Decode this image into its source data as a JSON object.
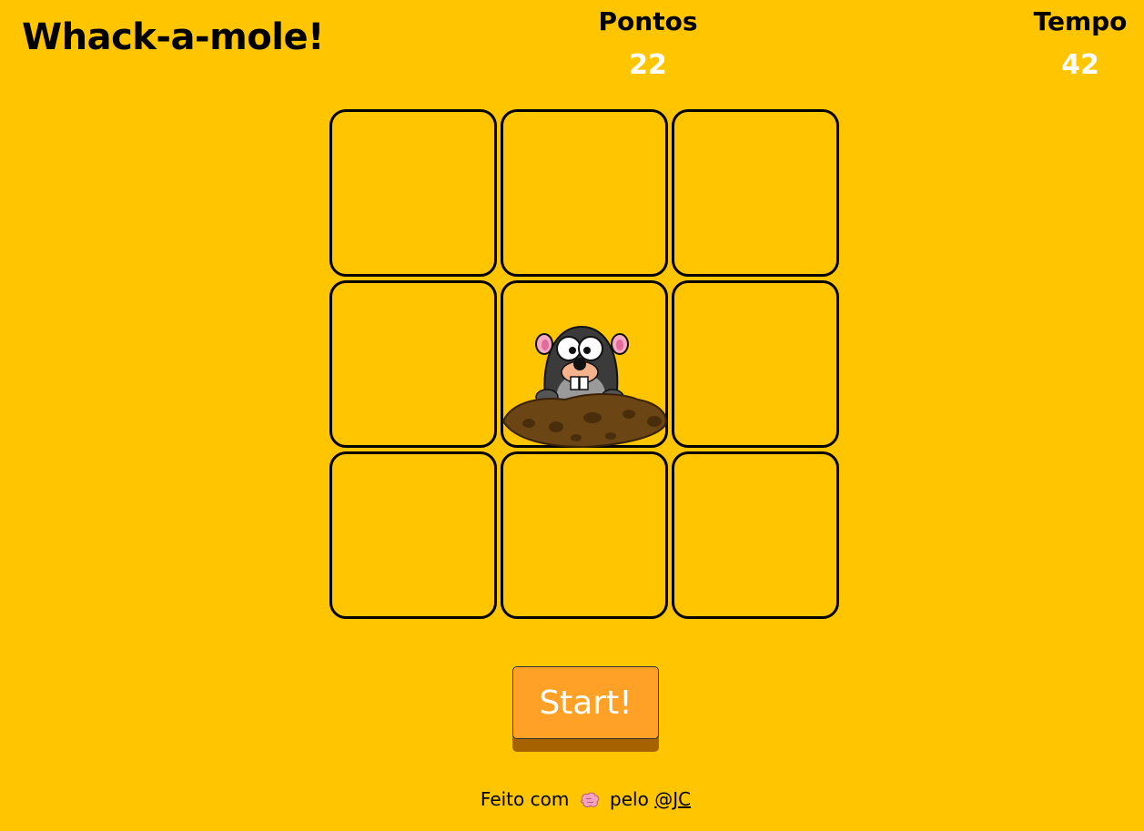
{
  "header": {
    "title": "Whack-a-mole!",
    "score_label": "Pontos",
    "score_value": "22",
    "time_label": "Tempo",
    "time_value": "42"
  },
  "board": {
    "rows": 3,
    "cols": 3,
    "mole_position": {
      "row": 2,
      "col": 2
    },
    "holes": [
      {
        "has_mole": false
      },
      {
        "has_mole": false
      },
      {
        "has_mole": false
      },
      {
        "has_mole": false
      },
      {
        "has_mole": true
      },
      {
        "has_mole": false
      },
      {
        "has_mole": false
      },
      {
        "has_mole": false
      },
      {
        "has_mole": false
      }
    ]
  },
  "start_button": {
    "label": "Start!"
  },
  "footer": {
    "prefix": "Feito com",
    "icon": "brain-icon",
    "middle": "pelo",
    "link_text": "@JC"
  },
  "colors": {
    "background": "#ffc600",
    "button": "#ffa126",
    "button_shadow": "#a76200",
    "stat_value": "#ffffff",
    "dirt": "#6b4513"
  }
}
